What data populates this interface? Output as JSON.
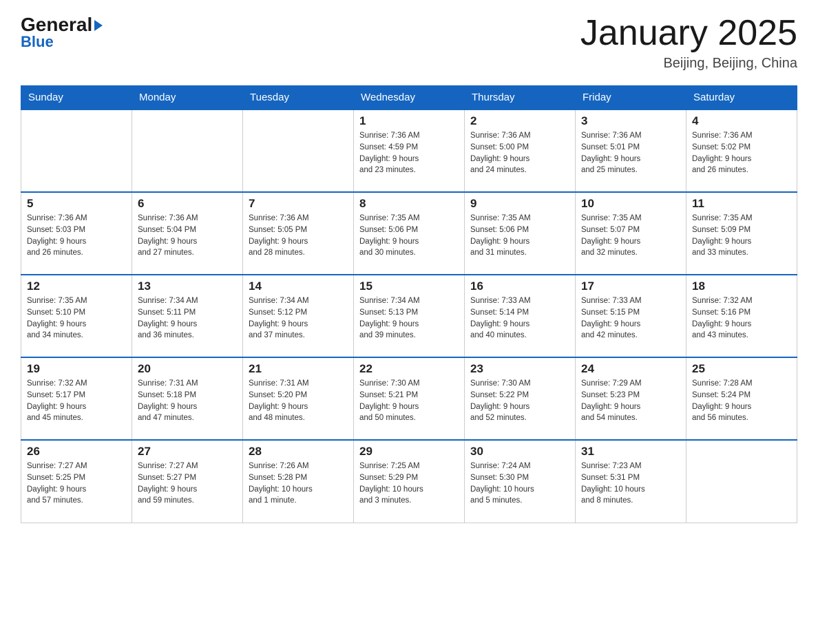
{
  "header": {
    "logo_general": "General",
    "logo_blue": "Blue",
    "month_title": "January 2025",
    "location": "Beijing, Beijing, China"
  },
  "weekdays": [
    "Sunday",
    "Monday",
    "Tuesday",
    "Wednesday",
    "Thursday",
    "Friday",
    "Saturday"
  ],
  "weeks": [
    [
      {
        "day": "",
        "info": ""
      },
      {
        "day": "",
        "info": ""
      },
      {
        "day": "",
        "info": ""
      },
      {
        "day": "1",
        "info": "Sunrise: 7:36 AM\nSunset: 4:59 PM\nDaylight: 9 hours\nand 23 minutes."
      },
      {
        "day": "2",
        "info": "Sunrise: 7:36 AM\nSunset: 5:00 PM\nDaylight: 9 hours\nand 24 minutes."
      },
      {
        "day": "3",
        "info": "Sunrise: 7:36 AM\nSunset: 5:01 PM\nDaylight: 9 hours\nand 25 minutes."
      },
      {
        "day": "4",
        "info": "Sunrise: 7:36 AM\nSunset: 5:02 PM\nDaylight: 9 hours\nand 26 minutes."
      }
    ],
    [
      {
        "day": "5",
        "info": "Sunrise: 7:36 AM\nSunset: 5:03 PM\nDaylight: 9 hours\nand 26 minutes."
      },
      {
        "day": "6",
        "info": "Sunrise: 7:36 AM\nSunset: 5:04 PM\nDaylight: 9 hours\nand 27 minutes."
      },
      {
        "day": "7",
        "info": "Sunrise: 7:36 AM\nSunset: 5:05 PM\nDaylight: 9 hours\nand 28 minutes."
      },
      {
        "day": "8",
        "info": "Sunrise: 7:35 AM\nSunset: 5:06 PM\nDaylight: 9 hours\nand 30 minutes."
      },
      {
        "day": "9",
        "info": "Sunrise: 7:35 AM\nSunset: 5:06 PM\nDaylight: 9 hours\nand 31 minutes."
      },
      {
        "day": "10",
        "info": "Sunrise: 7:35 AM\nSunset: 5:07 PM\nDaylight: 9 hours\nand 32 minutes."
      },
      {
        "day": "11",
        "info": "Sunrise: 7:35 AM\nSunset: 5:09 PM\nDaylight: 9 hours\nand 33 minutes."
      }
    ],
    [
      {
        "day": "12",
        "info": "Sunrise: 7:35 AM\nSunset: 5:10 PM\nDaylight: 9 hours\nand 34 minutes."
      },
      {
        "day": "13",
        "info": "Sunrise: 7:34 AM\nSunset: 5:11 PM\nDaylight: 9 hours\nand 36 minutes."
      },
      {
        "day": "14",
        "info": "Sunrise: 7:34 AM\nSunset: 5:12 PM\nDaylight: 9 hours\nand 37 minutes."
      },
      {
        "day": "15",
        "info": "Sunrise: 7:34 AM\nSunset: 5:13 PM\nDaylight: 9 hours\nand 39 minutes."
      },
      {
        "day": "16",
        "info": "Sunrise: 7:33 AM\nSunset: 5:14 PM\nDaylight: 9 hours\nand 40 minutes."
      },
      {
        "day": "17",
        "info": "Sunrise: 7:33 AM\nSunset: 5:15 PM\nDaylight: 9 hours\nand 42 minutes."
      },
      {
        "day": "18",
        "info": "Sunrise: 7:32 AM\nSunset: 5:16 PM\nDaylight: 9 hours\nand 43 minutes."
      }
    ],
    [
      {
        "day": "19",
        "info": "Sunrise: 7:32 AM\nSunset: 5:17 PM\nDaylight: 9 hours\nand 45 minutes."
      },
      {
        "day": "20",
        "info": "Sunrise: 7:31 AM\nSunset: 5:18 PM\nDaylight: 9 hours\nand 47 minutes."
      },
      {
        "day": "21",
        "info": "Sunrise: 7:31 AM\nSunset: 5:20 PM\nDaylight: 9 hours\nand 48 minutes."
      },
      {
        "day": "22",
        "info": "Sunrise: 7:30 AM\nSunset: 5:21 PM\nDaylight: 9 hours\nand 50 minutes."
      },
      {
        "day": "23",
        "info": "Sunrise: 7:30 AM\nSunset: 5:22 PM\nDaylight: 9 hours\nand 52 minutes."
      },
      {
        "day": "24",
        "info": "Sunrise: 7:29 AM\nSunset: 5:23 PM\nDaylight: 9 hours\nand 54 minutes."
      },
      {
        "day": "25",
        "info": "Sunrise: 7:28 AM\nSunset: 5:24 PM\nDaylight: 9 hours\nand 56 minutes."
      }
    ],
    [
      {
        "day": "26",
        "info": "Sunrise: 7:27 AM\nSunset: 5:25 PM\nDaylight: 9 hours\nand 57 minutes."
      },
      {
        "day": "27",
        "info": "Sunrise: 7:27 AM\nSunset: 5:27 PM\nDaylight: 9 hours\nand 59 minutes."
      },
      {
        "day": "28",
        "info": "Sunrise: 7:26 AM\nSunset: 5:28 PM\nDaylight: 10 hours\nand 1 minute."
      },
      {
        "day": "29",
        "info": "Sunrise: 7:25 AM\nSunset: 5:29 PM\nDaylight: 10 hours\nand 3 minutes."
      },
      {
        "day": "30",
        "info": "Sunrise: 7:24 AM\nSunset: 5:30 PM\nDaylight: 10 hours\nand 5 minutes."
      },
      {
        "day": "31",
        "info": "Sunrise: 7:23 AM\nSunset: 5:31 PM\nDaylight: 10 hours\nand 8 minutes."
      },
      {
        "day": "",
        "info": ""
      }
    ]
  ]
}
